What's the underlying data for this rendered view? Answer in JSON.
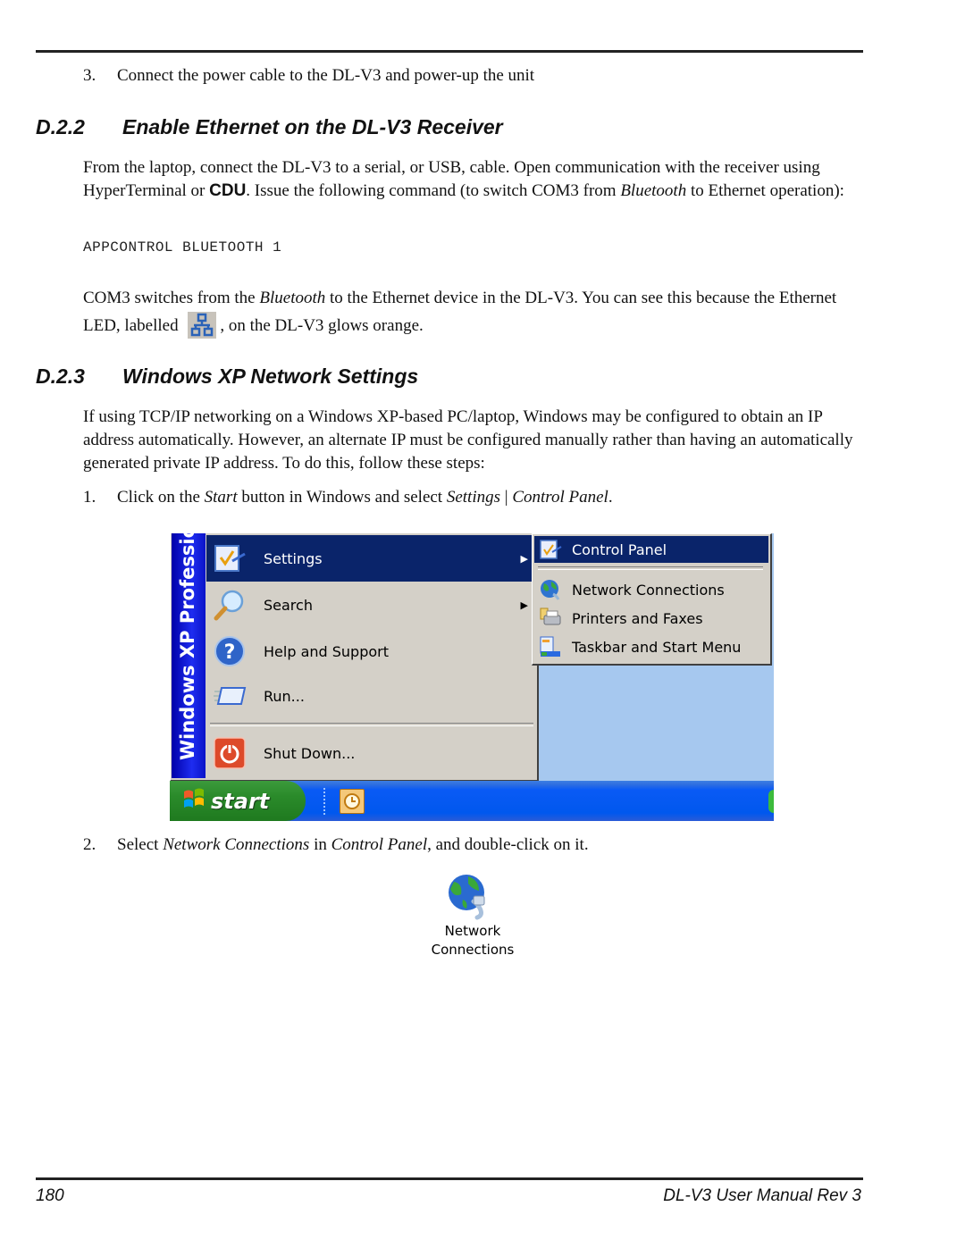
{
  "step3": {
    "number": "3.",
    "text": "Connect the power cable to the DL-V3 and power-up the unit"
  },
  "section_d22": {
    "number": "D.2.2",
    "title": "Enable Ethernet on the DL-V3 Receiver",
    "para1_part1": "From the laptop, connect the DL-V3 to a serial, or USB, cable. Open communication with the receiver using HyperTerminal or ",
    "para1_cdu": "CDU",
    "para1_part2": ". Issue the following command (to switch COM3 from ",
    "para1_bluetooth": "Bluetooth",
    "para1_part3": " to Ethernet operation):",
    "command": "APPCONTROL BLUETOOTH 1",
    "para2_part1": "COM3 switches from the ",
    "para2_bluetooth": "Bluetooth",
    "para2_part2": " to the Ethernet device in the DL-V3. You can see this because the Ethernet LED, labelled ",
    "para2_part3": ", on the DL-V3 glows orange.",
    "led_icon": "ethernet-network-icon"
  },
  "section_d23": {
    "number": "D.2.3",
    "title": "Windows XP Network Settings",
    "para": "If using TCP/IP networking on a Windows XP-based PC/laptop, Windows may be configured to obtain an IP address automatically. However, an alternate IP must be configured manually rather than having an automatically generated private IP address. To do this, follow these steps:",
    "step1": {
      "number": "1.",
      "part1": "Click on the ",
      "start": "Start",
      "part2": " button in Windows and select ",
      "settings": "Settings",
      "separator": " | ",
      "control_panel": "Control Panel",
      "part3": "."
    },
    "step2": {
      "number": "2.",
      "part1": "Select ",
      "network_connections": "Network Connections",
      "part2": " in ",
      "control_panel": "Control Panel",
      "part3": ", and double-click on it."
    }
  },
  "xp_screenshot": {
    "sidebar_text": "Windows XP Professional",
    "menu_items": [
      {
        "label": "Settings",
        "icon": "settings-icon",
        "has_submenu": true,
        "selected": true
      },
      {
        "label": "Search",
        "icon": "search-icon",
        "has_submenu": true,
        "selected": false
      },
      {
        "label": "Help and Support",
        "icon": "help-icon",
        "has_submenu": false,
        "selected": false
      },
      {
        "label": "Run...",
        "icon": "run-icon",
        "has_submenu": false,
        "selected": false
      },
      {
        "label": "Shut Down...",
        "icon": "shutdown-icon",
        "has_submenu": false,
        "selected": false
      }
    ],
    "submenu_items": [
      {
        "label": "Control Panel",
        "icon": "control-panel-icon",
        "selected": true
      },
      {
        "label": "Network Connections",
        "icon": "network-connections-icon",
        "selected": false
      },
      {
        "label": "Printers and Faxes",
        "icon": "printer-icon",
        "selected": false
      },
      {
        "label": "Taskbar and Start Menu",
        "icon": "taskbar-icon",
        "selected": false
      }
    ],
    "start_button": "start"
  },
  "network_connections_icon": {
    "label_line1": "Network",
    "label_line2": "Connections"
  },
  "footer": {
    "page_number": "180",
    "title": "DL-V3 User Manual Rev 3"
  }
}
